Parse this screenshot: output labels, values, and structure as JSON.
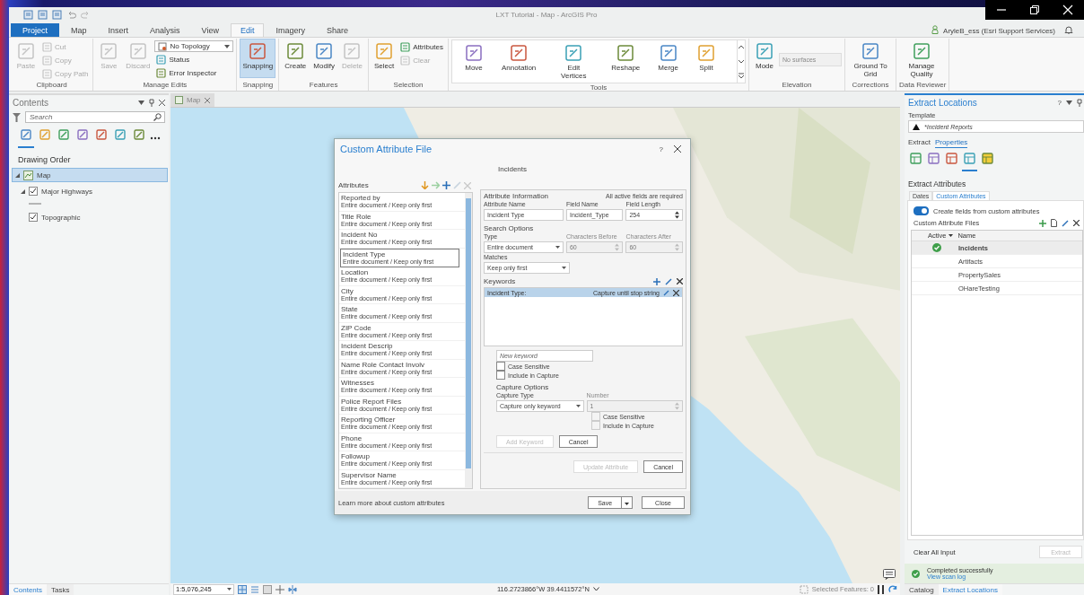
{
  "window": {
    "title": "LXT Tutorial - Map - ArcGIS Pro",
    "user": "AryleB_ess (Esri Support Services)"
  },
  "ribbon_tabs": [
    {
      "label": "Project",
      "kind": "backstage",
      "selected": false
    },
    {
      "label": "Map",
      "kind": "tab",
      "selected": false
    },
    {
      "label": "Insert",
      "kind": "tab",
      "selected": false
    },
    {
      "label": "Analysis",
      "kind": "tab",
      "selected": false
    },
    {
      "label": "View",
      "kind": "tab",
      "selected": false
    },
    {
      "label": "Edit",
      "kind": "tab",
      "selected": true
    },
    {
      "label": "Imagery",
      "kind": "tab",
      "selected": false
    },
    {
      "label": "Share",
      "kind": "tab",
      "selected": false
    }
  ],
  "ribbon_groups": [
    {
      "label": "Clipboard",
      "kind": "plain",
      "items": [
        {
          "label": "Paste",
          "kind": "large",
          "disabled": true,
          "on": false
        },
        {
          "label": "Cut",
          "kind": "small",
          "disabled": true,
          "on": false
        },
        {
          "label": "Copy",
          "kind": "small",
          "disabled": true,
          "on": false
        },
        {
          "label": "Copy Path",
          "kind": "small",
          "disabled": true,
          "on": false
        }
      ]
    },
    {
      "label": "Manage Edits",
      "kind": "plain",
      "items": [
        {
          "label": "Save",
          "kind": "large",
          "disabled": true,
          "on": false
        },
        {
          "label": "Discard",
          "kind": "large",
          "disabled": true,
          "on": false
        },
        {
          "label": "No Topology",
          "kind": "dropdown",
          "disabled": false,
          "on": false
        },
        {
          "label": "Status",
          "kind": "small",
          "disabled": false,
          "on": false
        },
        {
          "label": "Error Inspector",
          "kind": "small",
          "disabled": false,
          "on": false
        }
      ]
    },
    {
      "label": "Snapping",
      "kind": "plain",
      "items": [
        {
          "label": "Snapping",
          "kind": "large",
          "disabled": false,
          "on": true
        }
      ]
    },
    {
      "label": "Features",
      "kind": "plain",
      "items": [
        {
          "label": "Create",
          "kind": "large",
          "disabled": false,
          "on": false
        },
        {
          "label": "Modify",
          "kind": "large",
          "disabled": false,
          "on": false
        },
        {
          "label": "Delete",
          "kind": "large",
          "disabled": true,
          "on": false
        }
      ]
    },
    {
      "label": "Selection",
      "kind": "plain",
      "items": [
        {
          "label": "Select",
          "kind": "large",
          "disabled": false,
          "on": false
        },
        {
          "label": "Attributes",
          "kind": "small",
          "disabled": false,
          "on": false
        },
        {
          "label": "Clear",
          "kind": "small",
          "disabled": true,
          "on": false
        }
      ]
    },
    {
      "label": "Tools",
      "kind": "gallery",
      "items": [
        {
          "label": "Move",
          "kind": "large",
          "disabled": false,
          "on": false
        },
        {
          "label": "Annotation",
          "kind": "large",
          "disabled": false,
          "on": false
        },
        {
          "label": "Edit Vertices",
          "kind": "large",
          "disabled": false,
          "on": false
        },
        {
          "label": "Reshape",
          "kind": "large",
          "disabled": false,
          "on": false
        },
        {
          "label": "Merge",
          "kind": "large",
          "disabled": false,
          "on": false
        },
        {
          "label": "Split",
          "kind": "large",
          "disabled": false,
          "on": false
        }
      ]
    },
    {
      "label": "Elevation",
      "kind": "plain",
      "items": [
        {
          "label": "Mode",
          "kind": "large",
          "disabled": false,
          "on": false
        },
        {
          "label": "No surfaces",
          "kind": "field",
          "disabled": true,
          "on": false
        }
      ]
    },
    {
      "label": "Corrections",
      "kind": "plain",
      "items": [
        {
          "label": "Ground To Grid",
          "kind": "large",
          "disabled": false,
          "on": false
        }
      ]
    },
    {
      "label": "Data Reviewer",
      "kind": "plain",
      "items": [
        {
          "label": "Manage Quality",
          "kind": "large",
          "disabled": false,
          "on": false
        }
      ]
    }
  ],
  "contents": {
    "title": "Contents",
    "search_placeholder": "Search",
    "view_tabs": [
      {
        "selected": true
      },
      {
        "selected": false
      },
      {
        "selected": false
      },
      {
        "selected": false
      },
      {
        "selected": false
      },
      {
        "selected": false
      },
      {
        "selected": false
      }
    ],
    "heading": "Drawing Order",
    "tree": {
      "label": "Map",
      "selected": true,
      "expanded": true,
      "children": [
        {
          "label": "Major Highways",
          "checked": true,
          "expanded": true,
          "selected": false
        },
        {
          "label": "Topographic",
          "checked": true,
          "selected": false
        }
      ]
    },
    "bottom_tabs": [
      {
        "label": "Contents",
        "selected": true
      },
      {
        "label": "Tasks",
        "selected": false
      }
    ]
  },
  "map_view": {
    "tab": "Map",
    "scale": "1:5,076,245",
    "coordinates": "116.2723866°W 39.4411572°N",
    "selected_features": "Selected Features: 0"
  },
  "dialog": {
    "title": "Custom Attribute File",
    "help": "?",
    "subtitle": "Incidents",
    "attributes_label": "Attributes",
    "attributes": [
      {
        "name": "Reported by",
        "detail": "Entire document / Keep only first",
        "selected": false
      },
      {
        "name": "Title Role",
        "detail": "Entire document / Keep only first",
        "selected": false
      },
      {
        "name": "Incident No",
        "detail": "Entire document / Keep only first",
        "selected": false
      },
      {
        "name": "Incident Type",
        "detail": "Entire document / Keep only first",
        "selected": true
      },
      {
        "name": "Location",
        "detail": "Entire document / Keep only first",
        "selected": false
      },
      {
        "name": "City",
        "detail": "Entire document / Keep only first",
        "selected": false
      },
      {
        "name": "State",
        "detail": "Entire document / Keep only first",
        "selected": false
      },
      {
        "name": "ZIP Code",
        "detail": "Entire document / Keep only first",
        "selected": false
      },
      {
        "name": "Incident Descrip",
        "detail": "Entire document / Keep only first",
        "selected": false
      },
      {
        "name": "Name Role Contact Involv",
        "detail": "Entire document / Keep only first",
        "selected": false
      },
      {
        "name": "Witnesses",
        "detail": "Entire document / Keep only first",
        "selected": false
      },
      {
        "name": "Police Report Files",
        "detail": "Entire document / Keep only first",
        "selected": false
      },
      {
        "name": "Reporting Officer",
        "detail": "Entire document / Keep only first",
        "selected": false
      },
      {
        "name": "Phone",
        "detail": "Entire document / Keep only first",
        "selected": false
      },
      {
        "name": "Followup",
        "detail": "Entire document / Keep only first",
        "selected": false
      },
      {
        "name": "Supervisor Name",
        "detail": "Entire document / Keep only first",
        "selected": false
      }
    ],
    "info": {
      "heading": "Attribute Information",
      "note": "All active fields are required",
      "fields": [
        {
          "label": "Attribute Name",
          "value": "Incident Type",
          "kind": "text",
          "disabled": false
        },
        {
          "label": "Field Name",
          "value": "Incident_Type",
          "kind": "text",
          "disabled": false
        },
        {
          "label": "Field Length",
          "value": "254",
          "kind": "spin",
          "disabled": false
        }
      ]
    },
    "search": {
      "heading": "Search Options",
      "fields": [
        {
          "label": "Type",
          "value": "Entire document",
          "kind": "select",
          "disabled": false
        },
        {
          "label": "Characters Before",
          "value": "60",
          "kind": "spin",
          "disabled": true
        },
        {
          "label": "Characters After",
          "value": "60",
          "kind": "spin",
          "disabled": true
        }
      ],
      "matches": {
        "label": "Matches",
        "value": "Keep only first"
      }
    },
    "keywords": {
      "heading": "Keywords",
      "rows": [
        {
          "keyword": "Incident Type:",
          "capture": "Capture until stop string",
          "selected": true
        }
      ],
      "new_placeholder": "New keyword",
      "options": [
        {
          "label": "Case Sensitive",
          "checked": false,
          "disabled": false
        },
        {
          "label": "Include in Capture",
          "checked": false,
          "disabled": false
        }
      ]
    },
    "capture": {
      "heading": "Capture Options",
      "fields": [
        {
          "label": "Capture Type",
          "value": "Capture only keyword",
          "kind": "select",
          "disabled": false
        },
        {
          "label": "Number",
          "value": "1",
          "kind": "spin",
          "disabled": true
        }
      ],
      "options": [
        {
          "label": "Case Sensitive",
          "checked": false,
          "disabled": true
        },
        {
          "label": "Include in Capture",
          "checked": false,
          "disabled": true
        }
      ],
      "buttons": [
        {
          "label": "Add Keyword",
          "disabled": true
        },
        {
          "label": "Cancel",
          "disabled": false
        }
      ]
    },
    "form_buttons": [
      {
        "label": "Update Attribute",
        "disabled": true
      },
      {
        "label": "Cancel",
        "disabled": false
      }
    ],
    "link": "Learn more about custom attributes",
    "footer_buttons": [
      {
        "label": "Save",
        "kind": "split"
      },
      {
        "label": "Close",
        "kind": "plain"
      }
    ]
  },
  "extract_pane": {
    "title": "Extract Locations",
    "help": "?",
    "template_label": "Template",
    "template_value": "*Incident Reports",
    "tabs": [
      {
        "label": "Extract",
        "selected": false
      },
      {
        "label": "Properties",
        "selected": true
      }
    ],
    "icon_tabs": [
      {
        "selected": false
      },
      {
        "selected": false
      },
      {
        "selected": false
      },
      {
        "selected": true
      },
      {
        "selected": false
      }
    ],
    "section": "Extract Attributes",
    "sub_tabs": [
      {
        "label": "Dates",
        "selected": false
      },
      {
        "label": "Custom Attributes",
        "selected": true
      }
    ],
    "toggle": {
      "label": "Create fields from custom attributes",
      "on": true
    },
    "files_label": "Custom Attribute Files",
    "columns": [
      "Active",
      "Name"
    ],
    "files": [
      {
        "name": "Incidents",
        "active": true,
        "selected": true
      },
      {
        "name": "Artifacts",
        "active": false,
        "selected": false
      },
      {
        "name": "PropertySales",
        "active": false,
        "selected": false
      },
      {
        "name": "OHareTesting",
        "active": false,
        "selected": false
      }
    ],
    "clear_button": "Clear All Input",
    "extract_button": {
      "label": "Extract",
      "disabled": true
    },
    "status": {
      "message": "Completed successfully",
      "link": "View scan log"
    },
    "bottom_tabs": [
      {
        "label": "Catalog",
        "selected": false
      },
      {
        "label": "Extract Locations",
        "selected": true
      }
    ]
  }
}
